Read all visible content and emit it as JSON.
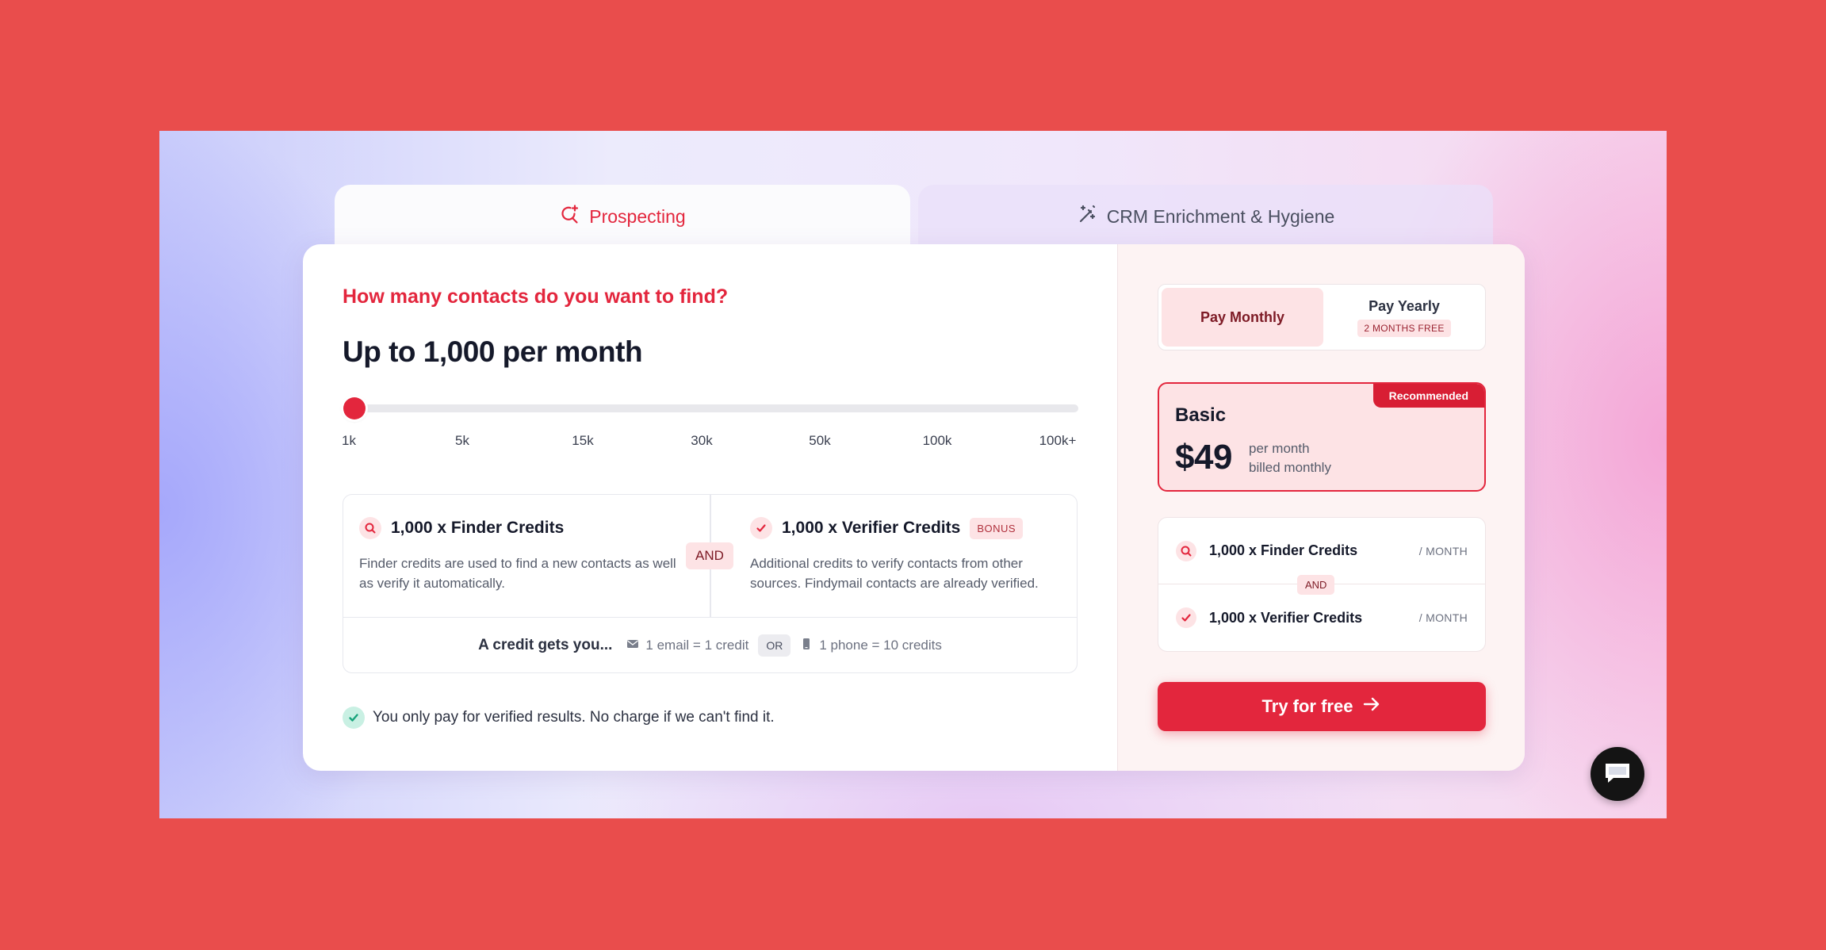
{
  "tabs": [
    {
      "label": "Prospecting",
      "icon": "search-sparkle-icon",
      "active": true
    },
    {
      "label": "CRM Enrichment & Hygiene",
      "icon": "magic-wand-icon",
      "active": false
    }
  ],
  "left": {
    "question": "How many contacts do you want to find?",
    "headline": "Up to 1,000 per month",
    "slider": {
      "value_index": 0,
      "ticks": [
        "1k",
        "5k",
        "15k",
        "30k",
        "50k",
        "100k",
        "100k+"
      ]
    },
    "finder": {
      "title": "1,000 x Finder Credits",
      "desc": "Finder credits are used to find a new contacts as well as verify it automatically."
    },
    "and_label": "AND",
    "verifier": {
      "title": "1,000 x Verifier Credits",
      "badge": "BONUS",
      "desc": "Additional credits to verify contacts from other sources. Findymail contacts are already verified."
    },
    "credit_gets": {
      "label": "A credit gets you...",
      "email": "1 email = 1 credit",
      "or": "OR",
      "phone": "1 phone = 10 credits"
    },
    "note": "You only pay for verified results. No charge if we can't find it."
  },
  "right": {
    "billing": {
      "monthly": "Pay Monthly",
      "yearly": "Pay Yearly",
      "yearly_badge": "2 MONTHS FREE",
      "selected": "monthly"
    },
    "plan": {
      "badge": "Recommended",
      "name": "Basic",
      "price": "$49",
      "per_line1": "per month",
      "per_line2": "billed monthly"
    },
    "includes": {
      "finder": "1,000 x Finder Credits",
      "and": "AND",
      "verifier": "1,000 x Verifier Credits",
      "unit": "/ MONTH"
    },
    "cta": "Try for free"
  },
  "colors": {
    "accent": "#e3263d",
    "outer_background": "#e94d4c",
    "pink_tint": "#fde3e5"
  }
}
